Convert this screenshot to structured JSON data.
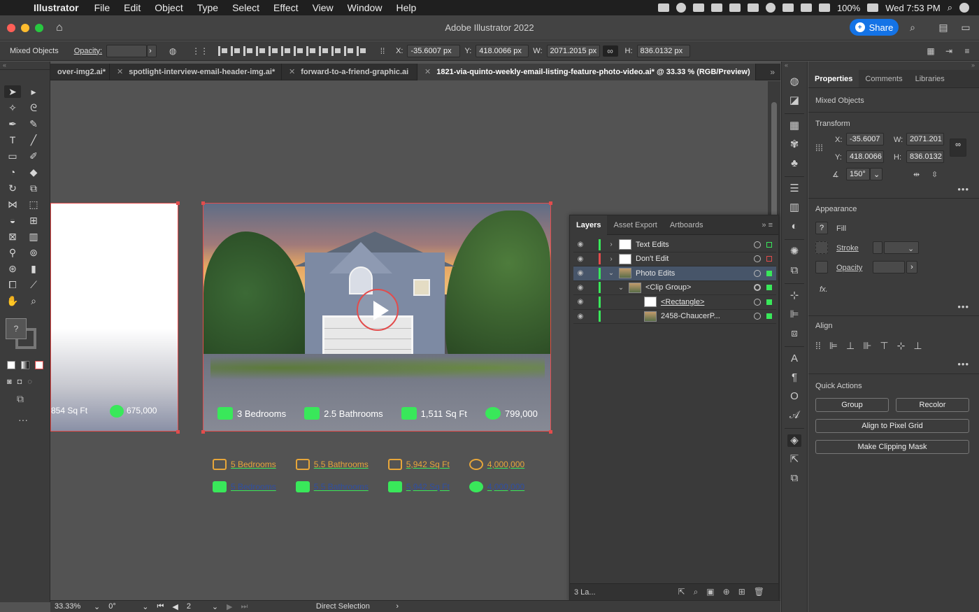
{
  "menubar": {
    "app_name": "Illustrator",
    "menus": [
      "File",
      "Edit",
      "Object",
      "Type",
      "Select",
      "Effect",
      "View",
      "Window",
      "Help"
    ],
    "battery": "100%",
    "clock": "Wed 7:53 PM"
  },
  "titlebar": {
    "title": "Adobe Illustrator 2022",
    "share_label": "Share"
  },
  "controlbar": {
    "selection_type": "Mixed Objects",
    "opacity_label": "Opacity:",
    "opacity_value": "",
    "x_label": "X:",
    "x_value": "-35.6007 px",
    "y_label": "Y:",
    "y_value": "418.0066 px",
    "w_label": "W:",
    "w_value": "2071.2015 px",
    "h_label": "H:",
    "h_value": "836.0132 px"
  },
  "tabs": [
    {
      "label": "over-img2.ai*"
    },
    {
      "label": "spotlight-interview-email-header-img.ai*"
    },
    {
      "label": "forward-to-a-friend-graphic.ai"
    },
    {
      "label": "1821-via-quinto-weekly-email-listing-feature-photo-video.ai* @ 33.33 % (RGB/Preview)"
    }
  ],
  "artboard_left": {
    "sqft": "854 Sq Ft",
    "price": "675,000"
  },
  "photo_artboard": {
    "stats": [
      {
        "label": "3 Bedrooms"
      },
      {
        "label": "2.5 Bathrooms"
      },
      {
        "label": "1,511 Sq Ft"
      },
      {
        "label": "799,000"
      }
    ]
  },
  "loose_items": {
    "row1": [
      "5 Bedrooms",
      "5.5 Bathrooms",
      "5,942 Sq Ft",
      "4,000,000"
    ],
    "row2": [
      "5 Bedrooms",
      "5.5 Bathrooms",
      "5,942 Sq Ft",
      "4,000,000"
    ]
  },
  "layers_panel": {
    "tabs": [
      "Layers",
      "Asset Export",
      "Artboards"
    ],
    "rows": [
      {
        "name": "Text Edits",
        "color": "#39e85a",
        "sel_color": "#39e85a"
      },
      {
        "name": "Don't Edit",
        "color": "#e24c4c",
        "sel_color": "#e24c4c"
      },
      {
        "name": "Photo Edits",
        "color": "#39e85a",
        "sel_color": "#39e85a"
      },
      {
        "name": "<Clip Group>",
        "color": "#39e85a",
        "sel_color": "#39e85a"
      },
      {
        "name": "<Rectangle>",
        "color": "#39e85a",
        "sel_color": "#39e85a"
      },
      {
        "name": "2458-ChaucerP...",
        "color": "#39e85a",
        "sel_color": "#39e85a"
      }
    ],
    "footer_count": "3 La..."
  },
  "properties": {
    "tabs": [
      "Properties",
      "Comments",
      "Libraries"
    ],
    "selection_type": "Mixed Objects",
    "transform_title": "Transform",
    "x_label": "X:",
    "x_value": "-35.6007",
    "y_label": "Y:",
    "y_value": "418.0066",
    "w_label": "W:",
    "w_value": "2071.201",
    "h_label": "H:",
    "h_value": "836.0132",
    "angle_value": "150°",
    "appearance_title": "Appearance",
    "fill_label": "Fill",
    "stroke_label": "Stroke",
    "opacity_label": "Opacity",
    "fx_label": "fx.",
    "align_title": "Align",
    "quick_actions_title": "Quick Actions",
    "group_btn": "Group",
    "recolor_btn": "Recolor",
    "align_pixel_btn": "Align to Pixel Grid",
    "clipping_btn": "Make Clipping Mask"
  },
  "statusbar": {
    "zoom": "33.33%",
    "rotation": "0°",
    "artboard_num": "2",
    "tool": "Direct Selection"
  }
}
